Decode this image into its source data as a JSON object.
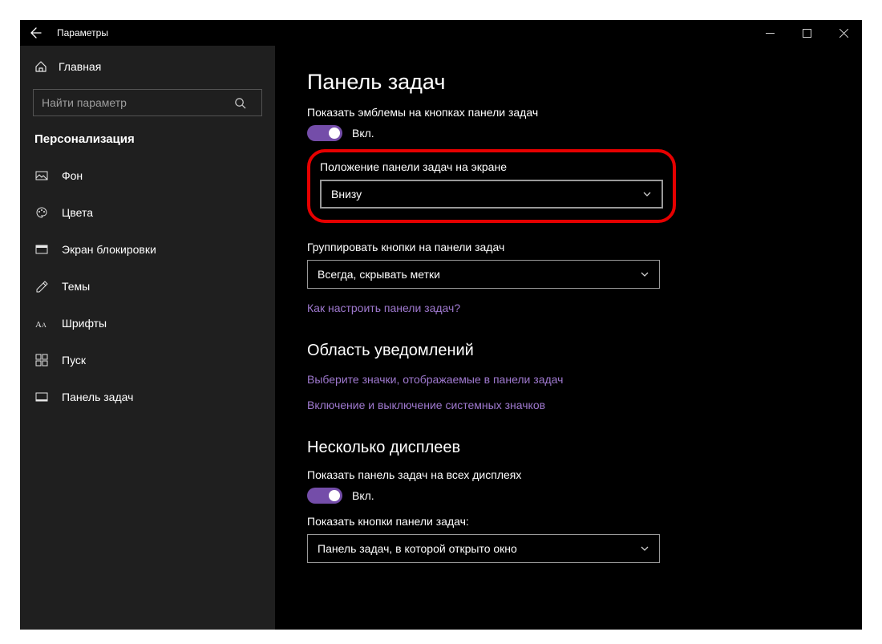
{
  "titlebar": {
    "title": "Параметры"
  },
  "sidebar": {
    "home": "Главная",
    "search_placeholder": "Найти параметр",
    "category": "Персонализация",
    "items": [
      {
        "label": "Фон"
      },
      {
        "label": "Цвета"
      },
      {
        "label": "Экран блокировки"
      },
      {
        "label": "Темы"
      },
      {
        "label": "Шрифты"
      },
      {
        "label": "Пуск"
      },
      {
        "label": "Панель задач"
      }
    ]
  },
  "content": {
    "page_title": "Панель задач",
    "badges": {
      "label": "Показать эмблемы на кнопках панели задач",
      "state": "Вкл."
    },
    "position": {
      "label": "Положение панели задач на экране",
      "value": "Внизу"
    },
    "grouping": {
      "label": "Группировать кнопки на панели задач",
      "value": "Всегда, скрывать метки"
    },
    "link_customize": "Как настроить панели задач?",
    "notifications": {
      "title": "Область уведомлений",
      "link_icons": "Выберите значки, отображаемые в панели задач",
      "link_system": "Включение и выключение системных значков"
    },
    "multi": {
      "title": "Несколько дисплеев",
      "show_all": {
        "label": "Показать панель задач на всех дисплеях",
        "state": "Вкл."
      },
      "buttons_on": {
        "label": "Показать кнопки панели задач:",
        "value": "Панель задач, в которой открыто окно"
      }
    }
  }
}
